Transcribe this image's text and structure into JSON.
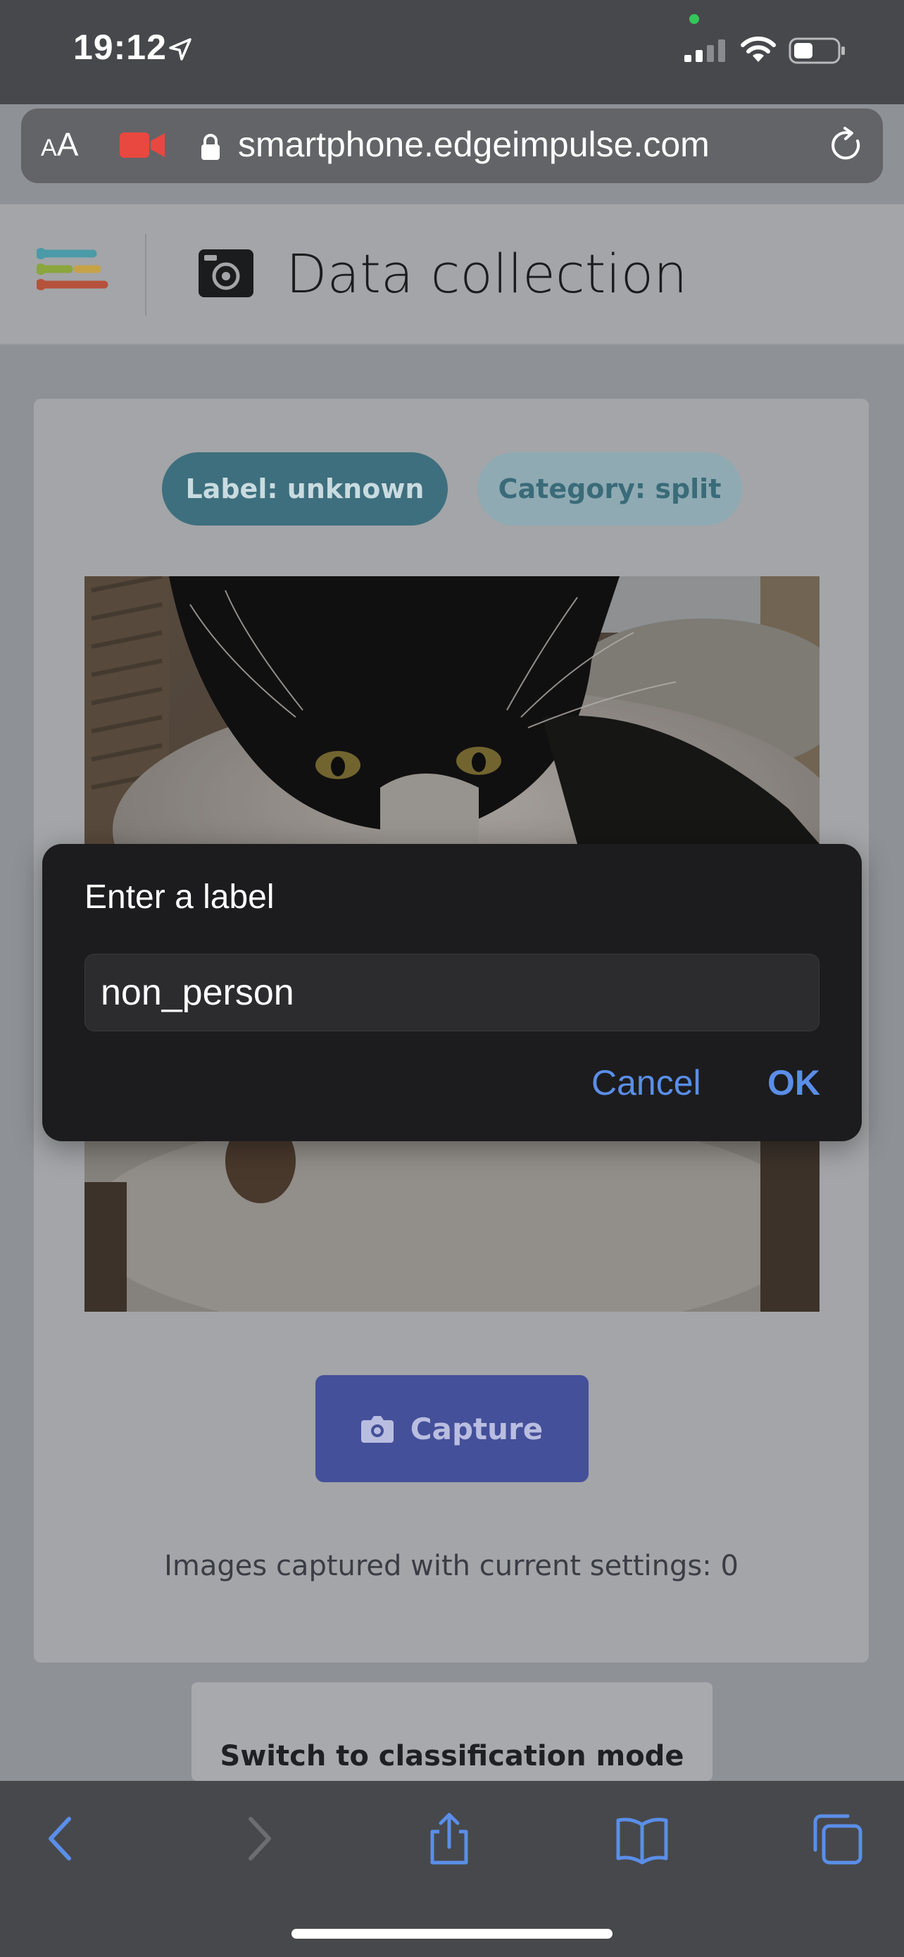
{
  "status_bar": {
    "time": "19:12",
    "icons": [
      "location-arrow-icon",
      "signal-icon",
      "wifi-icon",
      "battery-icon"
    ]
  },
  "address_bar": {
    "aa_small": "A",
    "aa_big": "A",
    "url": "smartphone.edgeimpulse.com",
    "icons": [
      "camera-recording-icon",
      "lock-icon",
      "reload-icon"
    ]
  },
  "header": {
    "title": "Data collection",
    "icons": [
      "edge-impulse-logo",
      "camera-icon"
    ]
  },
  "card": {
    "label_pill": "Label: unknown",
    "category_pill": "Category: split",
    "capture_button": "Capture",
    "images_captured": "Images captured with current settings: 0"
  },
  "switch_mode_button": "Switch to classification mode",
  "dialog": {
    "title": "Enter a label",
    "input_value": "non_person",
    "cancel_label": "Cancel",
    "ok_label": "OK"
  },
  "toolbar": {
    "icons": [
      "back-icon",
      "forward-icon",
      "share-icon",
      "bookmarks-icon",
      "tabs-icon"
    ]
  },
  "colors": {
    "accent_blue": "#5a8ee8",
    "capture_button": "#45509a",
    "label_pill": "#3e6f7e",
    "category_pill": "#8faab3",
    "recording_red": "#e8483f"
  }
}
